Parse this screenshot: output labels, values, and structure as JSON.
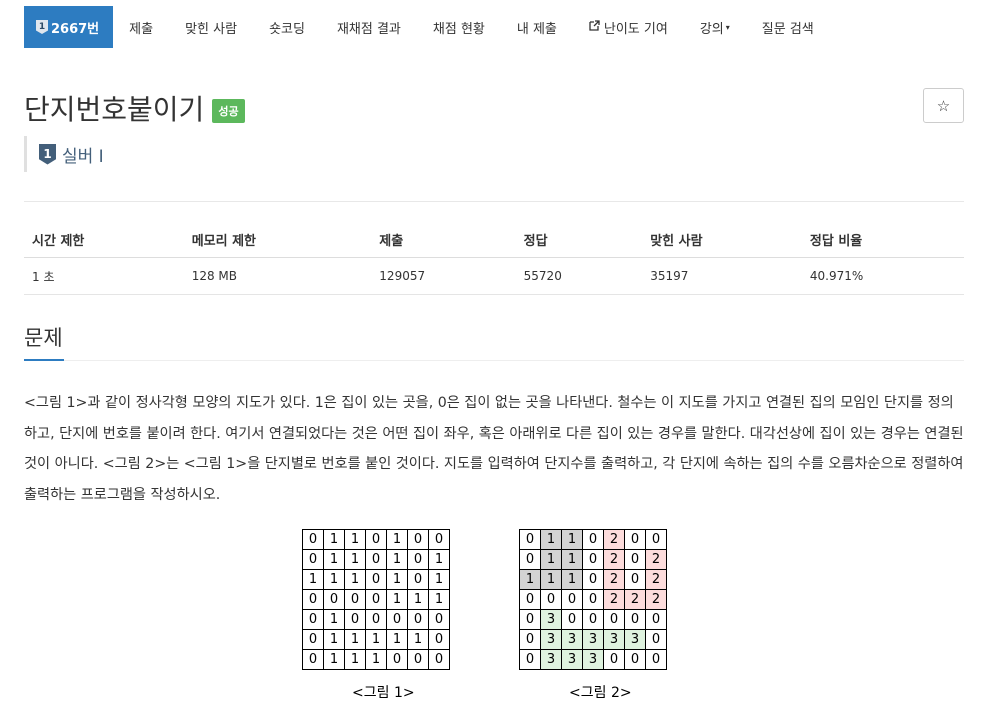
{
  "nav": {
    "problem_no": "2667번",
    "problem_badge": "1",
    "items": [
      "제출",
      "맞힌 사람",
      "숏코딩",
      "재채점 결과",
      "채점 현황",
      "내 제출",
      "난이도 기여",
      "강의",
      "질문 검색"
    ],
    "ext_icon": "external-link-icon",
    "caret": "▾"
  },
  "title": "단지번호붙이기",
  "result_badge": "성공",
  "star": "☆",
  "tier": {
    "number": "1",
    "label": "실버 I"
  },
  "info": {
    "headers": [
      "시간 제한",
      "메모리 제한",
      "제출",
      "정답",
      "맞힌 사람",
      "정답 비율"
    ],
    "values": [
      "1 초",
      "128 MB",
      "129057",
      "55720",
      "35197",
      "40.971%"
    ]
  },
  "section_title": "문제",
  "problem_text": "<그림 1>과 같이 정사각형 모양의 지도가 있다. 1은 집이 있는 곳을, 0은 집이 없는 곳을 나타낸다. 철수는 이 지도를 가지고 연결된 집의 모임인 단지를 정의하고, 단지에 번호를 붙이려 한다. 여기서 연결되었다는 것은 어떤 집이 좌우, 혹은 아래위로 다른 집이 있는 경우를 말한다. 대각선상에 집이 있는 경우는 연결된 것이 아니다. <그림 2>는 <그림 1>을 단지별로 번호를 붙인 것이다. 지도를 입력하여 단지수를 출력하고, 각 단지에 속하는 집의 수를 오름차순으로 정렬하여 출력하는 프로그램을 작성하시오.",
  "figure1": {
    "caption": "<그림 1>",
    "rows": [
      [
        "0",
        "1",
        "1",
        "0",
        "1",
        "0",
        "0"
      ],
      [
        "0",
        "1",
        "1",
        "0",
        "1",
        "0",
        "1"
      ],
      [
        "1",
        "1",
        "1",
        "0",
        "1",
        "0",
        "1"
      ],
      [
        "0",
        "0",
        "0",
        "0",
        "1",
        "1",
        "1"
      ],
      [
        "0",
        "1",
        "0",
        "0",
        "0",
        "0",
        "0"
      ],
      [
        "0",
        "1",
        "1",
        "1",
        "1",
        "1",
        "0"
      ],
      [
        "0",
        "1",
        "1",
        "1",
        "0",
        "0",
        "0"
      ]
    ]
  },
  "figure2": {
    "caption": "<그림 2>",
    "rows": [
      [
        "0",
        "1",
        "1",
        "0",
        "2",
        "0",
        "0"
      ],
      [
        "0",
        "1",
        "1",
        "0",
        "2",
        "0",
        "2"
      ],
      [
        "1",
        "1",
        "1",
        "0",
        "2",
        "0",
        "2"
      ],
      [
        "0",
        "0",
        "0",
        "0",
        "2",
        "2",
        "2"
      ],
      [
        "0",
        "3",
        "0",
        "0",
        "0",
        "0",
        "0"
      ],
      [
        "0",
        "3",
        "3",
        "3",
        "3",
        "3",
        "0"
      ],
      [
        "0",
        "3",
        "3",
        "3",
        "0",
        "0",
        "0"
      ]
    ],
    "colors": {
      "1": "#d3d3d3",
      "2": "#fddcdc",
      "3": "#dff3df"
    }
  }
}
